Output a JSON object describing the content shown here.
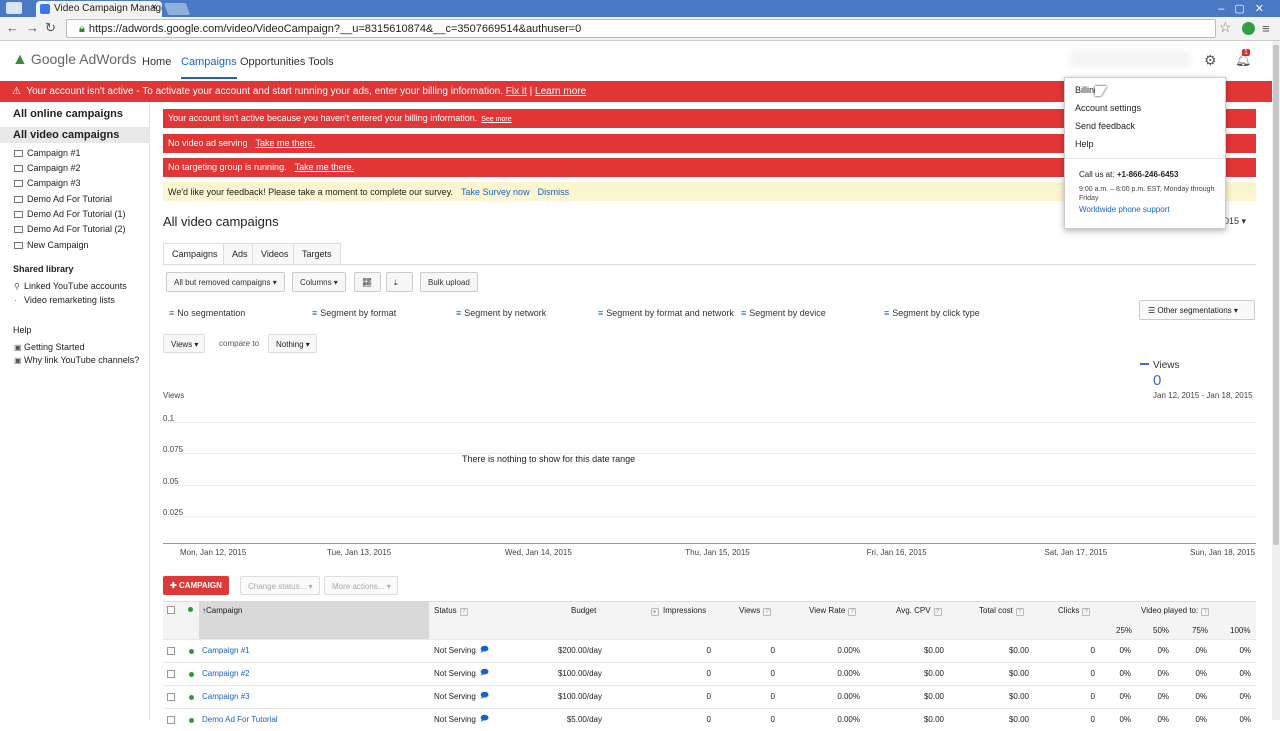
{
  "browser": {
    "tab_title": "Video Campaign Manage",
    "tab_close": "×",
    "url": "https://adwords.google.com/video/VideoCampaign?__u=8315610874&__c=3507669514&authuser=0"
  },
  "header": {
    "logo": "Google AdWords",
    "nav": [
      "Home",
      "Campaigns",
      "Opportunities",
      "Tools"
    ],
    "notification_count": "1"
  },
  "alert": {
    "text": "Your account isn't active - To activate your account and start running your ads, enter your billing information.",
    "fix": "Fix it",
    "learn": "Learn more"
  },
  "sidebar": {
    "all_online": "All online campaigns",
    "all_video": "All video campaigns",
    "campaigns": [
      "Campaign #1",
      "Campaign #2",
      "Campaign #3",
      "Demo Ad For Tutorial",
      "Demo Ad For Tutorial (1)",
      "Demo Ad For Tutorial (2)",
      "New Campaign"
    ],
    "shared_title": "Shared library",
    "shared_items": [
      "Linked YouTube accounts",
      "Video remarketing lists"
    ],
    "help_title": "Help",
    "help_items": [
      "Getting Started",
      "Why link YouTube channels?"
    ]
  },
  "notices": {
    "billing": "Your account isn't active because you haven't entered your billing information.",
    "billing_link": "See more",
    "no_ad": "No video ad serving",
    "no_ad_link": "Take me there.",
    "no_target": "No targeting group is running.",
    "no_target_link": "Take me there.",
    "feedback": "We'd like your feedback! Please take a moment to complete our survey.",
    "survey": "Take Survey now",
    "dismiss": "Dismiss"
  },
  "page": {
    "title": "All video campaigns",
    "date_fragment": "015"
  },
  "tabs": [
    "Campaigns",
    "Ads",
    "Videos",
    "Targets"
  ],
  "toolbar": {
    "filter": "All but removed campaigns",
    "columns": "Columns",
    "bulk": "Bulk upload"
  },
  "segments": [
    "No segmentation",
    "Segment by format",
    "Segment by network",
    "Segment by format and network",
    "Segment by device",
    "Segment by click type"
  ],
  "other_segmentations": "Other segmentations",
  "compare": {
    "metric": "Views",
    "label": "compare to",
    "other": "Nothing"
  },
  "chart": {
    "legend_name": "Views",
    "legend_value": "0",
    "legend_dates": "Jan 12, 2015 - Jan 18, 2015",
    "ylabel": "Views",
    "empty_message": "There is nothing to show for this date range"
  },
  "chart_data": {
    "type": "line",
    "ylabel": "Views",
    "y_ticks": [
      "0.1",
      "0.075",
      "0.05",
      "0.025"
    ],
    "categories": [
      "Mon, Jan 12, 2015",
      "Tue, Jan 13, 2015",
      "Wed, Jan 14, 2015",
      "Thu, Jan 15, 2015",
      "Fri, Jan 16, 2015",
      "Sat, Jan 17, 2015",
      "Sun, Jan 18, 2015"
    ],
    "series": [
      {
        "name": "Views",
        "values": []
      }
    ],
    "ylim": [
      0,
      0.1
    ],
    "grid": true
  },
  "actions": {
    "campaign": "CAMPAIGN",
    "change_status": "Change status...",
    "more_actions": "More actions..."
  },
  "table": {
    "headers": [
      "Campaign",
      "Status",
      "Budget",
      "Impressions",
      "Views",
      "View Rate",
      "Avg. CPV",
      "Total cost",
      "Clicks",
      "Video played to:"
    ],
    "played": [
      "25%",
      "50%",
      "75%",
      "100%"
    ],
    "rows": [
      {
        "name": "Campaign #1",
        "status": "Not Serving",
        "budget": "$200.00/day",
        "impressions": "0",
        "views": "0",
        "view_rate": "0.00%",
        "cpv": "$0.00",
        "cost": "$0.00",
        "clicks": "0",
        "p25": "0%",
        "p50": "0%",
        "p75": "0%",
        "p100": "0%"
      },
      {
        "name": "Campaign #2",
        "status": "Not Serving",
        "budget": "$100.00/day",
        "impressions": "0",
        "views": "0",
        "view_rate": "0.00%",
        "cpv": "$0.00",
        "cost": "$0.00",
        "clicks": "0",
        "p25": "0%",
        "p50": "0%",
        "p75": "0%",
        "p100": "0%"
      },
      {
        "name": "Campaign #3",
        "status": "Not Serving",
        "budget": "$100.00/day",
        "impressions": "0",
        "views": "0",
        "view_rate": "0.00%",
        "cpv": "$0.00",
        "cost": "$0.00",
        "clicks": "0",
        "p25": "0%",
        "p50": "0%",
        "p75": "0%",
        "p100": "0%"
      },
      {
        "name": "Demo Ad For Tutorial",
        "status": "Not Serving",
        "budget": "$5.00/day",
        "impressions": "0",
        "views": "0",
        "view_rate": "0.00%",
        "cpv": "$0.00",
        "cost": "$0.00",
        "clicks": "0",
        "p25": "0%",
        "p50": "0%",
        "p75": "0%",
        "p100": "0%"
      }
    ]
  },
  "account_menu": {
    "items": [
      "Billing",
      "Account settings",
      "Send feedback",
      "Help"
    ],
    "call_label": "Call us at:",
    "phone": "+1-866-246-6453",
    "hours": "9:00 a.m. – 8:00 p.m. EST, Monday through Friday",
    "worldwide": "Worldwide phone support"
  },
  "colors": {
    "alert_red": "#e23636",
    "link_blue": "#1a62c6",
    "serving_green": "#2a9a3a"
  }
}
